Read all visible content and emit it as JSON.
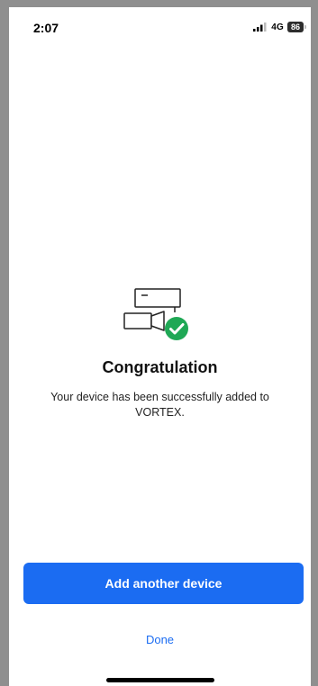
{
  "status_bar": {
    "time": "2:07",
    "network": "4G",
    "battery_level": "86",
    "signal_icon": "cellular-signal-icon",
    "battery_icon": "battery-icon"
  },
  "hero": {
    "illustration_icon": "devices-camera-success-icon",
    "title": "Congratulation",
    "message": "Your device has been successfully added to VORTEX."
  },
  "actions": {
    "add_another_label": "Add another device",
    "done_label": "Done"
  },
  "colors": {
    "accent": "#1b6cf2",
    "success": "#1fa855"
  }
}
